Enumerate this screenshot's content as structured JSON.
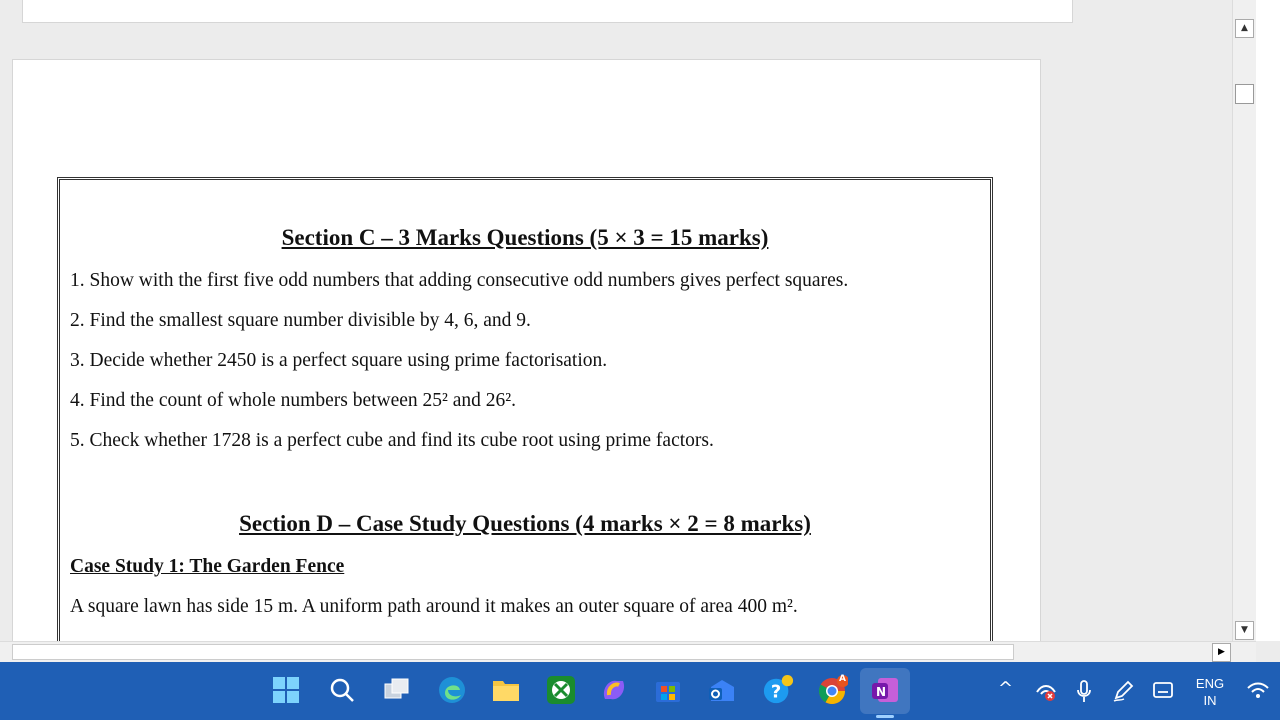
{
  "document": {
    "section_c": {
      "heading": "Section C – 3 Marks Questions (5 × 3 = 15 marks)",
      "questions": [
        "1. Show with the first five odd numbers that adding consecutive odd numbers gives perfect squares.",
        "2. Find the smallest square number divisible by 4, 6, and 9.",
        "3. Decide whether 2450 is a perfect square using prime factorisation.",
        "4. Find the count of whole numbers between 25² and 26².",
        "5. Check whether 1728 is a perfect cube and find its cube root using prime factors."
      ]
    },
    "section_d": {
      "heading": "Section D – Case Study Questions (4 marks × 2 = 8 marks)",
      "case_study_1_title": "Case Study 1: The Garden Fence",
      "case_study_1_text": "A square lawn has side 15 m. A uniform path around it makes an outer square of area 400 m²."
    }
  },
  "scrollbars": {
    "up_arrow": "▲",
    "down_arrow": "▼",
    "right_arrow": "▶"
  },
  "taskbar": {
    "icons": [
      "windows-start-icon",
      "search-icon",
      "task-view-icon",
      "edge-icon",
      "file-explorer-icon",
      "xbox-icon",
      "copilot-icon",
      "microsoft-store-icon",
      "outlook-icon",
      "get-help-icon",
      "chrome-icon",
      "onenote-icon"
    ],
    "onenote_label": "N",
    "chrome_badge": "A",
    "tray": {
      "chevron": "^",
      "language_line1": "ENG",
      "language_line2": "IN"
    }
  }
}
